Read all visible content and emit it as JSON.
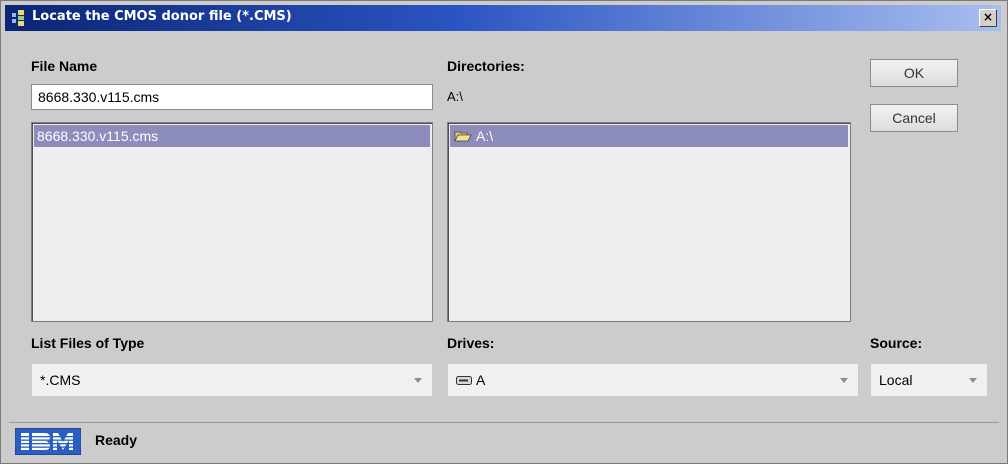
{
  "window": {
    "title": "Locate the CMOS donor file (*.CMS)",
    "close_label": "×"
  },
  "file_name": {
    "label": "File Name",
    "value": "8668.330.v115.cms",
    "files": [
      "8668.330.v115.cms"
    ]
  },
  "directories": {
    "label": "Directories:",
    "current_path": "A:\\",
    "items": [
      "A:\\"
    ]
  },
  "buttons": {
    "ok": "OK",
    "cancel": "Cancel"
  },
  "file_type": {
    "label": "List Files of Type",
    "selected": "*.CMS"
  },
  "drives": {
    "label": "Drives:",
    "selected": "A"
  },
  "source": {
    "label": "Source:",
    "selected": "Local"
  },
  "status": {
    "logo_text": "IBM",
    "text": "Ready"
  },
  "colors": {
    "selection": "#8c8cbd",
    "title_start": "#0b2574",
    "ibm_blue": "#2b5ec2"
  }
}
